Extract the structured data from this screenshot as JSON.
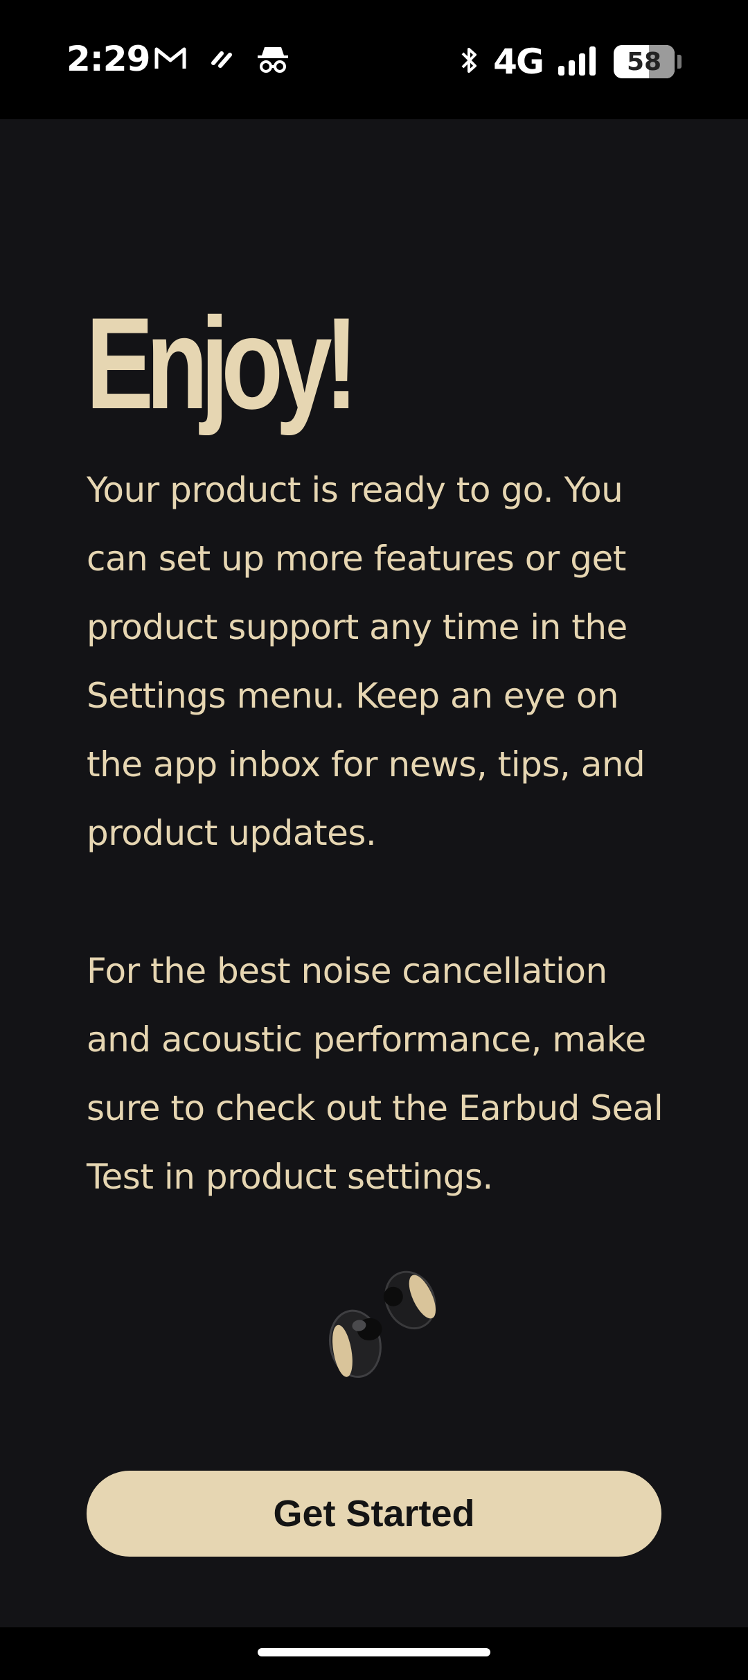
{
  "status_bar": {
    "time": "2:29",
    "left_icons": [
      "gmail-icon",
      "app-notification-icon",
      "incognito-icon"
    ],
    "network": "4G",
    "battery_level": "58"
  },
  "screen": {
    "title": "Enjoy!",
    "paragraph_1": "Your product is ready to go. You can set up more features or get product support any time in the Settings menu. Keep an eye on the app inbox for news, tips, and product updates.",
    "paragraph_2": "For the best noise cancellation and acoustic performance, make sure to check out the Earbud Seal Test in product settings.",
    "cta_label": "Get Started"
  },
  "colors": {
    "accent": "#e6d6b2",
    "background": "#131316"
  }
}
